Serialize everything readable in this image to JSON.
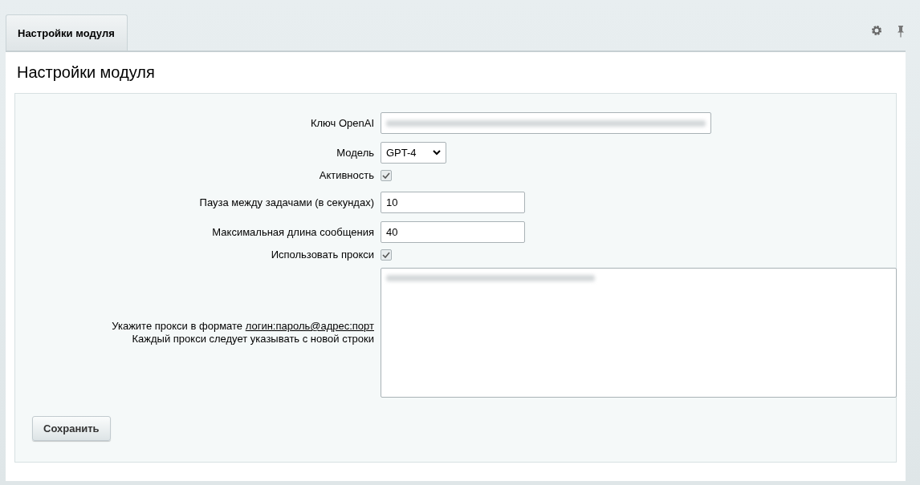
{
  "tabs": [
    {
      "label": "Настройки модуля",
      "selected": true
    }
  ],
  "heading": "Настройки модуля",
  "fields": [
    {
      "kind": "secret",
      "label": "Ключ OpenAI"
    },
    {
      "kind": "select",
      "label": "Модель",
      "value": "GPT-4"
    },
    {
      "kind": "checkbox",
      "label": "Активность",
      "checked": true
    },
    {
      "kind": "number",
      "label": "Пауза между задачами (в секундах)",
      "value": "10"
    },
    {
      "kind": "number",
      "label": "Максимальная длина сообщения",
      "value": "40"
    },
    {
      "kind": "checkbox",
      "label": "Использовать прокси",
      "checked": true
    },
    {
      "kind": "textarea",
      "hint": "Укажите прокси в формате",
      "link": "логин:пароль@адрес:порт",
      "hint_line2": "Каждый прокси следует указывать с новой строки"
    }
  ],
  "save_button": "Сохранить"
}
